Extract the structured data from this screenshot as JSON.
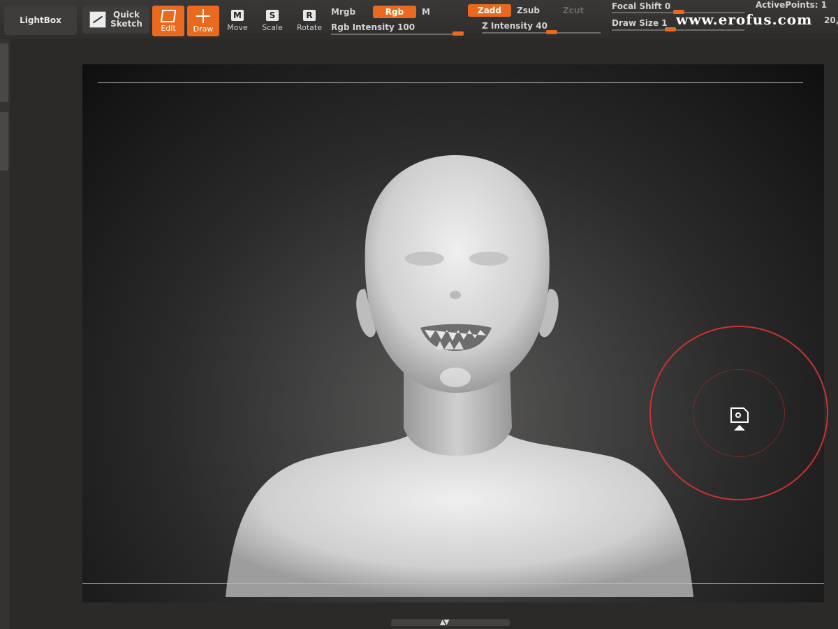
{
  "toolbar": {
    "lightbox": "LightBox",
    "quick_sketch_line1": "Quick",
    "quick_sketch_line2": "Sketch",
    "edit": "Edit",
    "draw": "Draw",
    "move_key": "M",
    "move": "Move",
    "scale_key": "S",
    "scale": "Scale",
    "rotate_key": "R",
    "rotate": "Rotate",
    "mrgb": "Mrgb",
    "rgb": "Rgb",
    "m": "M",
    "rgb_intensity": "Rgb  Intensity 100",
    "zadd": "Zadd",
    "zsub": "Zsub",
    "zcut": "Zcut",
    "z_intensity": "Z  Intensity 40",
    "focal_shift": "Focal  Shift 0",
    "draw_size": "Draw  Size 1",
    "active_points": "ActivePoints: 1",
    "active_points_value": "20,"
  },
  "sliders": {
    "rgb_intensity_value": 100,
    "z_intensity_value": 40,
    "focal_shift_value": 0
  },
  "watermark": "www.erofus.com",
  "colors": {
    "accent": "#e96a1e",
    "brush_ring": "#c9332f",
    "background": "#2b2a29"
  },
  "icons": {
    "quick_sketch": "sketch-icon",
    "edit": "edit-icon",
    "draw": "draw-icon",
    "brush_cursor": "brush-cursor-icon"
  }
}
